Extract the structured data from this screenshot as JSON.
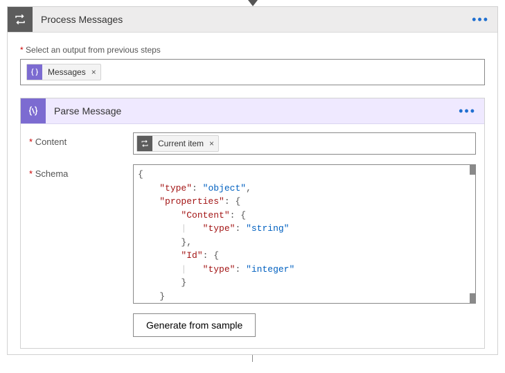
{
  "outerCard": {
    "title": "Process Messages",
    "selectLabel": "Select an output from previous steps",
    "selectToken": "Messages"
  },
  "innerCard": {
    "title": "Parse Message",
    "contentLabel": "Content",
    "contentToken": "Current item",
    "schemaLabel": "Schema",
    "schemaLine0a": "{",
    "schemaLine1a": "\"type\"",
    "schemaLine1b": ": ",
    "schemaLine1c": "\"object\"",
    "schemaLine1d": ",",
    "schemaLine2a": "\"properties\"",
    "schemaLine2b": ": {",
    "schemaLine3a": "\"Content\"",
    "schemaLine3b": ": {",
    "schemaLine4a": "\"type\"",
    "schemaLine4b": ": ",
    "schemaLine4c": "\"string\"",
    "schemaLine5a": "},",
    "schemaLine6a": "\"Id\"",
    "schemaLine6b": ": {",
    "schemaLine7a": "\"type\"",
    "schemaLine7b": ": ",
    "schemaLine7c": "\"integer\"",
    "schemaLine8a": "}",
    "schemaLine9a": "}",
    "generateButton": "Generate from sample"
  }
}
